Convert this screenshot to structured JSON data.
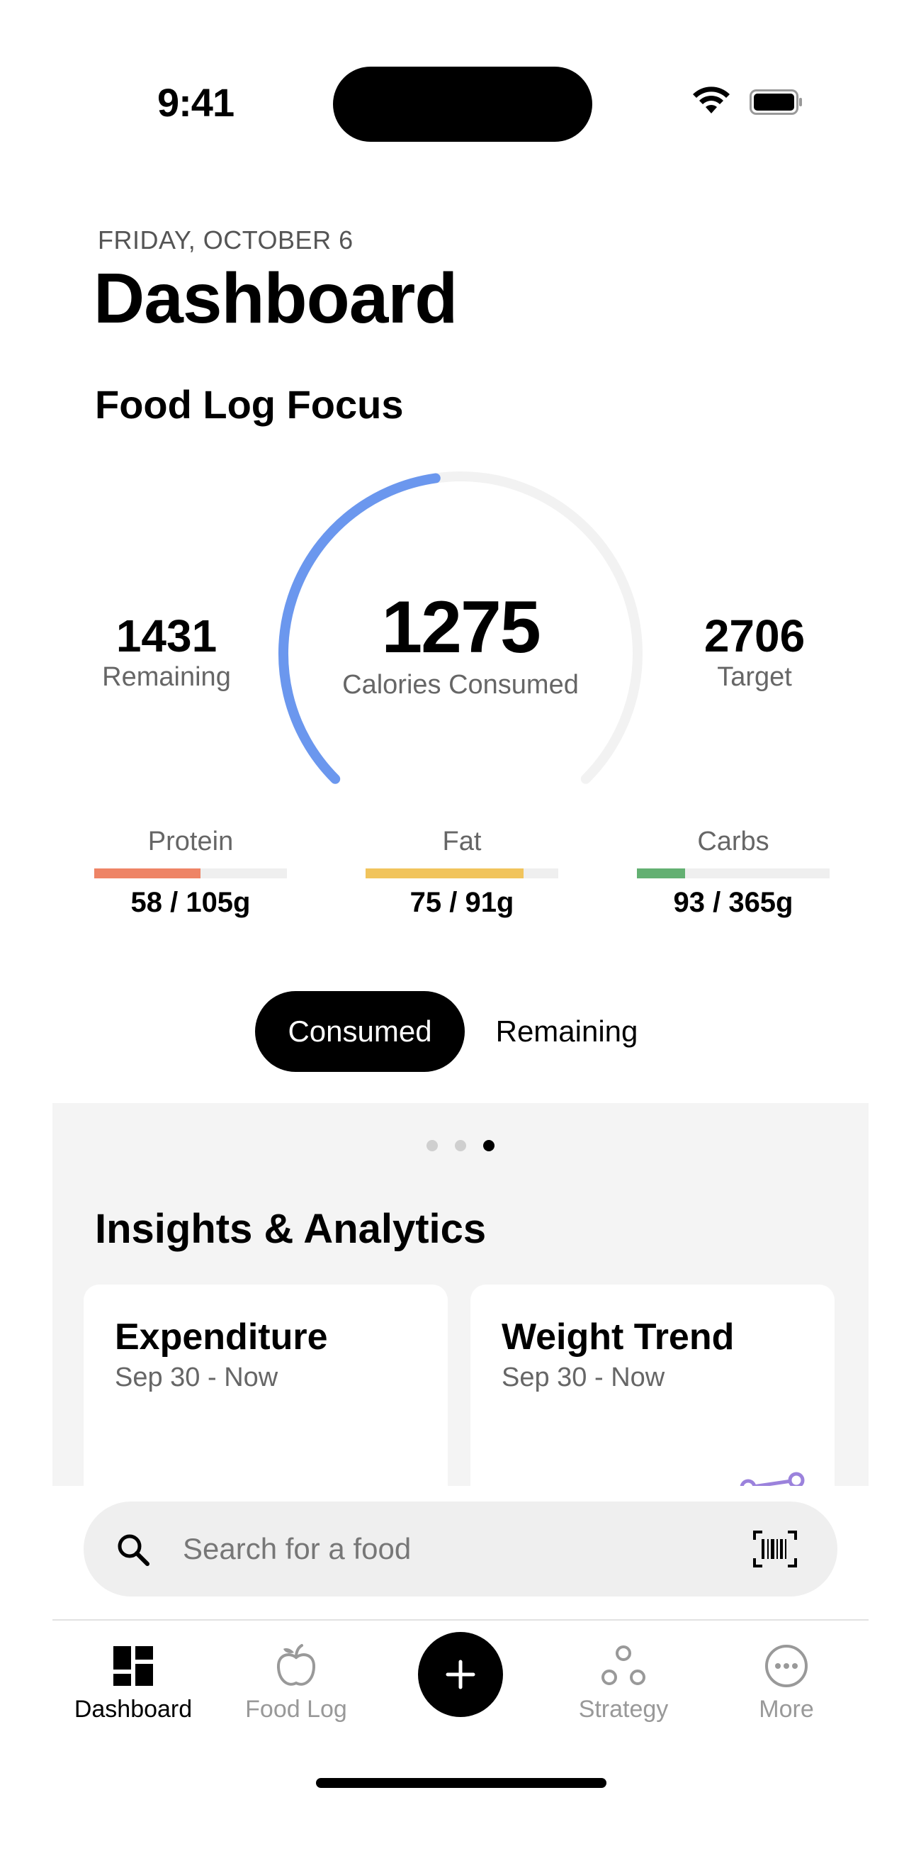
{
  "status_bar": {
    "time": "9:41"
  },
  "header": {
    "date": "FRIDAY, OCTOBER 6",
    "title": "Dashboard"
  },
  "food_log_focus": {
    "title": "Food Log Focus",
    "remaining": {
      "value": "1431",
      "label": "Remaining"
    },
    "consumed": {
      "value": "1275",
      "label": "Calories Consumed"
    },
    "target": {
      "value": "2706",
      "label": "Target"
    },
    "gauge_progress": 0.47,
    "gauge_color": "#6b97ee"
  },
  "macros": [
    {
      "label": "Protein",
      "value": "58 / 105g",
      "fraction": 0.55,
      "color": "#ee8466"
    },
    {
      "label": "Fat",
      "value": "75 / 91g",
      "fraction": 0.82,
      "color": "#f1c45c"
    },
    {
      "label": "Carbs",
      "value": "93 / 365g",
      "fraction": 0.25,
      "color": "#63b072"
    }
  ],
  "segmented": {
    "consumed": "Consumed",
    "remaining": "Remaining",
    "selected": "Consumed"
  },
  "insights": {
    "title": "Insights & Analytics",
    "page_dots": 3,
    "active_dot": 3,
    "cards": [
      {
        "title": "Expenditure",
        "subtitle": "Sep 30 - Now",
        "color": "#ee8466"
      },
      {
        "title": "Weight Trend",
        "subtitle": "Sep 30 - Now",
        "color": "#9b82dc"
      }
    ]
  },
  "search": {
    "placeholder": "Search for a food"
  },
  "tab_bar": {
    "dashboard": "Dashboard",
    "food_log": "Food Log",
    "strategy": "Strategy",
    "more": "More",
    "active": "Dashboard"
  }
}
